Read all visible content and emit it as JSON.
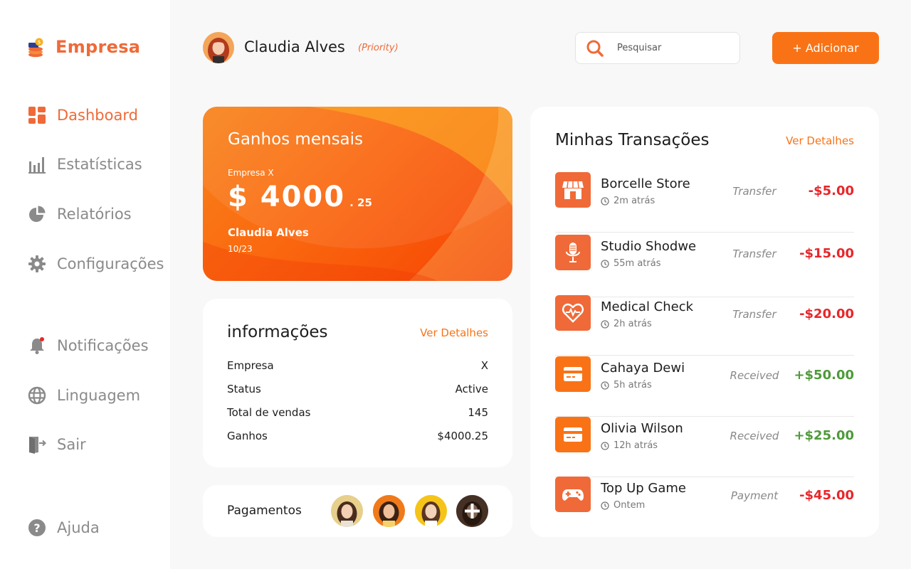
{
  "sidebar": {
    "brand": "Empresa",
    "items": [
      {
        "label": "Dashboard",
        "icon": "dashboard-icon"
      },
      {
        "label": "Estatísticas",
        "icon": "bar-chart-icon"
      },
      {
        "label": "Relatórios",
        "icon": "pie-chart-icon"
      },
      {
        "label": "Configurações",
        "icon": "gear-icon"
      },
      {
        "label": "Notificações",
        "icon": "bell-icon"
      },
      {
        "label": "Linguagem",
        "icon": "globe-icon"
      },
      {
        "label": "Sair",
        "icon": "logout-icon"
      },
      {
        "label": "Ajuda",
        "icon": "help-icon"
      }
    ],
    "active_index": 0
  },
  "header": {
    "user_name": "Claudia Alves",
    "priority": "(Priority)",
    "search_placeholder": "Pesquisar",
    "add_button": "+ Adicionar"
  },
  "earnings_card": {
    "title": "Ganhos  mensais",
    "company": "Empresa X",
    "amount_main": "$ 4000",
    "amount_cents": ". 25",
    "holder": "Claudia Alves",
    "date": "10/23"
  },
  "info": {
    "title": "informações",
    "link": "Ver Detalhes",
    "rows": [
      {
        "label": "Empresa",
        "value": "X"
      },
      {
        "label": "Status",
        "value": "Active"
      },
      {
        "label": "Total de vendas",
        "value": "145"
      },
      {
        "label": "Ganhos",
        "value": "$4000.25"
      }
    ]
  },
  "payments": {
    "label": "Pagamentos"
  },
  "transactions": {
    "title": "Minhas Transações",
    "link": "Ver Detalhes",
    "items": [
      {
        "name": "Borcelle Store",
        "time": "2m atrás",
        "type": "Transfer",
        "amount": "-$5.00",
        "icon": "store-icon"
      },
      {
        "name": "Studio Shodwe",
        "time": "55m atrás",
        "type": "Transfer",
        "amount": "-$15.00",
        "icon": "microphone-icon"
      },
      {
        "name": "Medical Check",
        "time": "2h atrás",
        "type": "Transfer",
        "amount": "-$20.00",
        "icon": "heartbeat-icon"
      },
      {
        "name": "Cahaya Dewi",
        "time": "5h atrás",
        "type": "Received",
        "amount": "+$50.00",
        "icon": "card-icon"
      },
      {
        "name": "Olivia Wilson",
        "time": "12h atrás",
        "type": "Received",
        "amount": "+$25.00",
        "icon": "card-icon"
      },
      {
        "name": "Top Up Game",
        "time": "Ontem",
        "type": "Payment",
        "amount": "-$45.00",
        "icon": "gamepad-icon"
      }
    ]
  },
  "colors": {
    "accent": "#f97316",
    "brand": "#ef6a38",
    "negative": "#e8262a",
    "positive": "#4f9a3a"
  }
}
